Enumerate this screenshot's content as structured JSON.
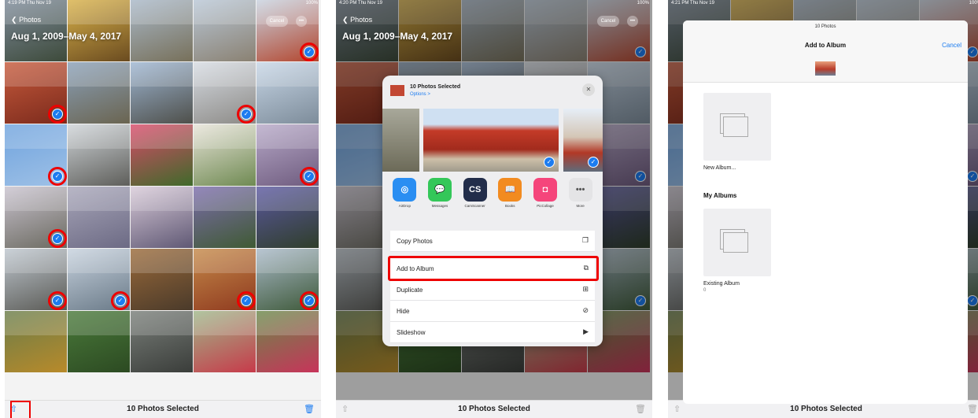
{
  "panel1": {
    "status_time": "4:19 PM  Thu Nov 19",
    "status_batt": "100%",
    "back_label": "Photos",
    "date_range": "Aug 1, 2009–May 4, 2017",
    "cancel_label": "Cancel",
    "more_label": "•••",
    "bottom_label": "10 Photos Selected"
  },
  "panel2": {
    "status_time": "4:20 PM  Thu Nov 19",
    "status_batt": "100%",
    "back_label": "Photos",
    "date_range": "Aug 1, 2009–May 4, 2017",
    "cancel_label": "Cancel",
    "more_label": "•••",
    "bottom_label": "10 Photos Selected",
    "sheet": {
      "title": "10 Photos Selected",
      "options": "Options >",
      "apps": [
        {
          "name": "AirDrop",
          "icon": "airdrop-icon",
          "glyph": "◎",
          "color": "#2a8ef2"
        },
        {
          "name": "Messages",
          "icon": "messages-icon",
          "glyph": "💬",
          "color": "#34c759"
        },
        {
          "name": "CamScanner",
          "icon": "camscanner-icon",
          "glyph": "CS",
          "color": "#222d4a"
        },
        {
          "name": "Books",
          "icon": "books-icon",
          "glyph": "📖",
          "color": "#f28b20"
        },
        {
          "name": "PicCollage",
          "icon": "piccollage-icon",
          "glyph": "◘",
          "color": "#f5457b"
        },
        {
          "name": "More",
          "icon": "more-icon",
          "glyph": "•••",
          "color": "#e4e4e6"
        }
      ],
      "actions_a": [
        {
          "label": "Copy Photos",
          "icon": "copy-icon",
          "glyph": "❐"
        }
      ],
      "actions_b": [
        {
          "label": "Add to Album",
          "icon": "add-album-icon",
          "glyph": "⧉"
        },
        {
          "label": "Duplicate",
          "icon": "duplicate-icon",
          "glyph": "⊞"
        },
        {
          "label": "Hide",
          "icon": "hide-icon",
          "glyph": "⊘"
        },
        {
          "label": "Slideshow",
          "icon": "slideshow-icon",
          "glyph": "▶"
        }
      ]
    }
  },
  "panel3": {
    "status_time": "4:21 PM  Thu Nov 19",
    "status_batt": "100%",
    "bottom_label": "10 Photos Selected",
    "modal": {
      "subtitle": "10 Photos",
      "title": "Add to Album",
      "cancel": "Cancel",
      "new_album": "New Album...",
      "section": "My Albums",
      "existing_album": "Existing Album",
      "existing_count": "0"
    }
  },
  "colors": {
    "accent": "#1c7cf0",
    "highlight": "#e00000"
  }
}
